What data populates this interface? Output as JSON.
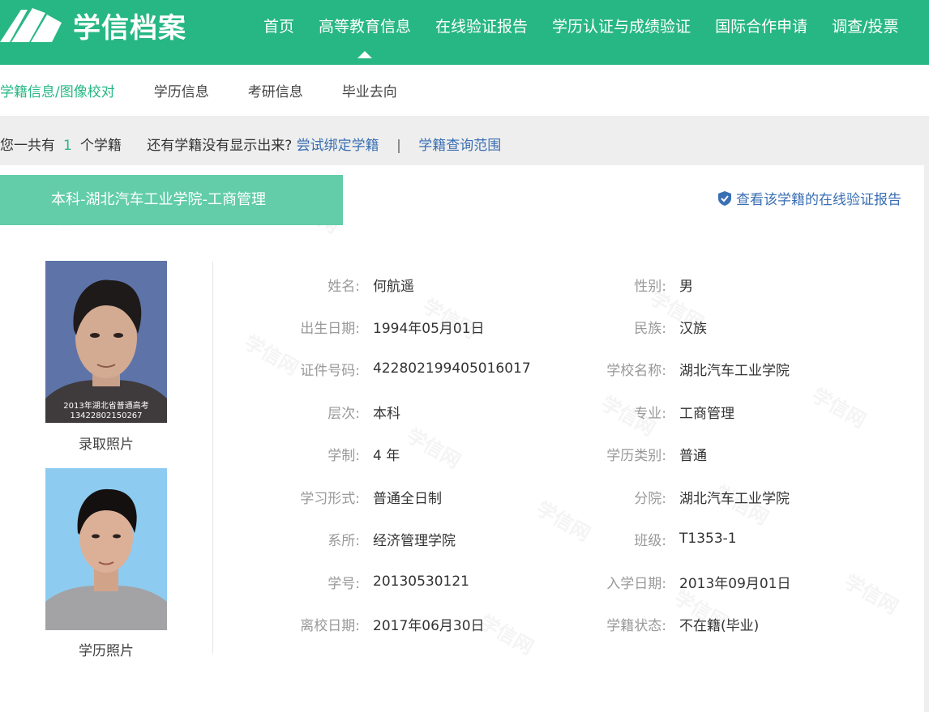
{
  "header": {
    "logo_text": "学信档案",
    "nav": [
      {
        "label": "首页"
      },
      {
        "label": "高等教育信息"
      },
      {
        "label": "在线验证报告"
      },
      {
        "label": "学历认证与成绩验证"
      },
      {
        "label": "国际合作申请"
      },
      {
        "label": "调查/投票"
      }
    ]
  },
  "subnav": [
    {
      "label": "学籍信息/图像校对"
    },
    {
      "label": "学历信息"
    },
    {
      "label": "考研信息"
    },
    {
      "label": "毕业去向"
    }
  ],
  "summary": {
    "prefix": "您一共有",
    "count": "1",
    "suffix": "个学籍",
    "question": "还有学籍没有显示出来?",
    "link_bind": "尝试绑定学籍",
    "separator": "|",
    "link_scope": "学籍查询范围"
  },
  "record": {
    "tab_title": "本科-湖北汽车工业学院-工商管理",
    "verify_link": "查看该学籍的在线验证报告",
    "watermark": "学信网",
    "photos": {
      "admission_caption": "录取照片",
      "admission_stamp_line1": "2013年湖北省普通高考",
      "admission_stamp_line2": "13422802150267",
      "degree_caption": "学历照片"
    },
    "left_fields": [
      {
        "label": "姓名:",
        "value": "何航遥"
      },
      {
        "label": "出生日期:",
        "value": "1994年05月01日"
      },
      {
        "label": "证件号码:",
        "value": "422802199405016017"
      },
      {
        "label": "层次:",
        "value": "本科"
      },
      {
        "label": "学制:",
        "value": "4 年"
      },
      {
        "label": "学习形式:",
        "value": "普通全日制"
      },
      {
        "label": "系所:",
        "value": "经济管理学院"
      },
      {
        "label": "学号:",
        "value": "20130530121"
      },
      {
        "label": "离校日期:",
        "value": "2017年06月30日"
      }
    ],
    "right_fields": [
      {
        "label": "性别:",
        "value": "男"
      },
      {
        "label": "民族:",
        "value": "汉族"
      },
      {
        "label": "学校名称:",
        "value": "湖北汽车工业学院"
      },
      {
        "label": "专业:",
        "value": "工商管理"
      },
      {
        "label": "学历类别:",
        "value": "普通"
      },
      {
        "label": "分院:",
        "value": "湖北汽车工业学院"
      },
      {
        "label": "班级:",
        "value": "T1353-1"
      },
      {
        "label": "入学日期:",
        "value": "2013年09月01日"
      },
      {
        "label": "学籍状态:",
        "value": "不在籍(毕业)"
      }
    ]
  },
  "colors": {
    "brand_green": "#27b784",
    "tab_green": "#62cda8",
    "link_blue": "#3a6fb3"
  }
}
